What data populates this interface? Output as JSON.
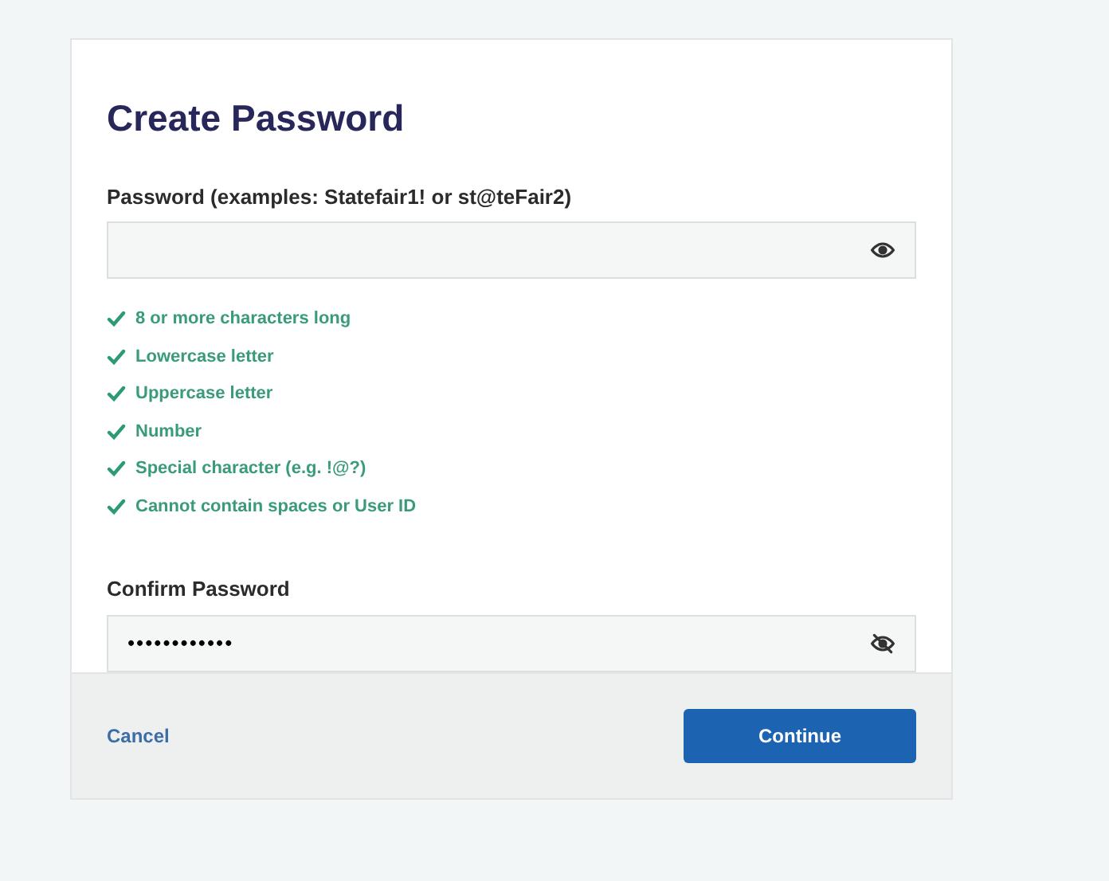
{
  "title": "Create Password",
  "password_field": {
    "label": "Password (examples: Statefair1! or st@teFair2)",
    "hidden": false
  },
  "requirements": [
    {
      "text": "8 or more characters long",
      "met": true
    },
    {
      "text": "Lowercase letter",
      "met": true
    },
    {
      "text": "Uppercase letter",
      "met": true
    },
    {
      "text": "Number",
      "met": true
    },
    {
      "text": "Special character (e.g. !@?)",
      "met": true
    },
    {
      "text": "Cannot contain spaces or User ID",
      "met": true
    }
  ],
  "confirm_field": {
    "label": "Confirm Password",
    "value": "••••••••••••",
    "hidden": true
  },
  "footer": {
    "cancel": "Cancel",
    "continue": "Continue"
  }
}
